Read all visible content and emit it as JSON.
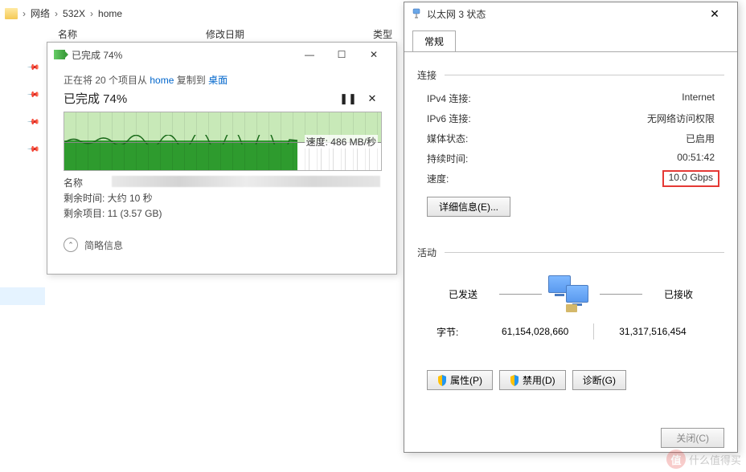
{
  "breadcrumb": {
    "items": [
      "网络",
      "532X",
      "home"
    ],
    "sep": "›"
  },
  "columns": {
    "name": "名称",
    "modified": "修改日期",
    "type": "类型"
  },
  "copy_dialog": {
    "title": "已完成 74%",
    "info_prefix": "正在将 20 个项目从 ",
    "info_src": "home",
    "info_mid": " 复制到 ",
    "info_dst": "桌面",
    "progress_text": "已完成 74%",
    "pause_glyph": "❚❚",
    "cancel_glyph": "✕",
    "speed_label": "速度: 486 MB/秒",
    "name_label": "名称",
    "remaining_time": "剩余时间: 大约 10 秒",
    "remaining_items": "剩余项目: 11 (3.57 GB)",
    "brief_info": "简略信息",
    "chevron": "⌃",
    "minimize": "—",
    "maximize": "☐",
    "close": "✕"
  },
  "eth_dialog": {
    "title": "以太网 3 状态",
    "close": "✕",
    "tab": "常规",
    "section_conn": "连接",
    "rows": {
      "ipv4_lbl": "IPv4 连接:",
      "ipv4_val": "Internet",
      "ipv6_lbl": "IPv6 连接:",
      "ipv6_val": "无网络访问权限",
      "media_lbl": "媒体状态:",
      "media_val": "已启用",
      "duration_lbl": "持续时间:",
      "duration_val": "00:51:42",
      "speed_lbl": "速度:",
      "speed_val": "10.0 Gbps"
    },
    "details_btn": "详细信息(E)...",
    "section_act": "活动",
    "sent_lbl": "已发送",
    "recv_lbl": "已接收",
    "bytes_lbl": "字节:",
    "bytes_sent": "61,154,028,660",
    "bytes_recv": "31,317,516,454",
    "btn_props": "属性(P)",
    "btn_disable": "禁用(D)",
    "btn_diag": "诊断(G)",
    "btn_close": "关闭(C)"
  },
  "watermark": {
    "badge": "值",
    "text": "什么值得买"
  }
}
